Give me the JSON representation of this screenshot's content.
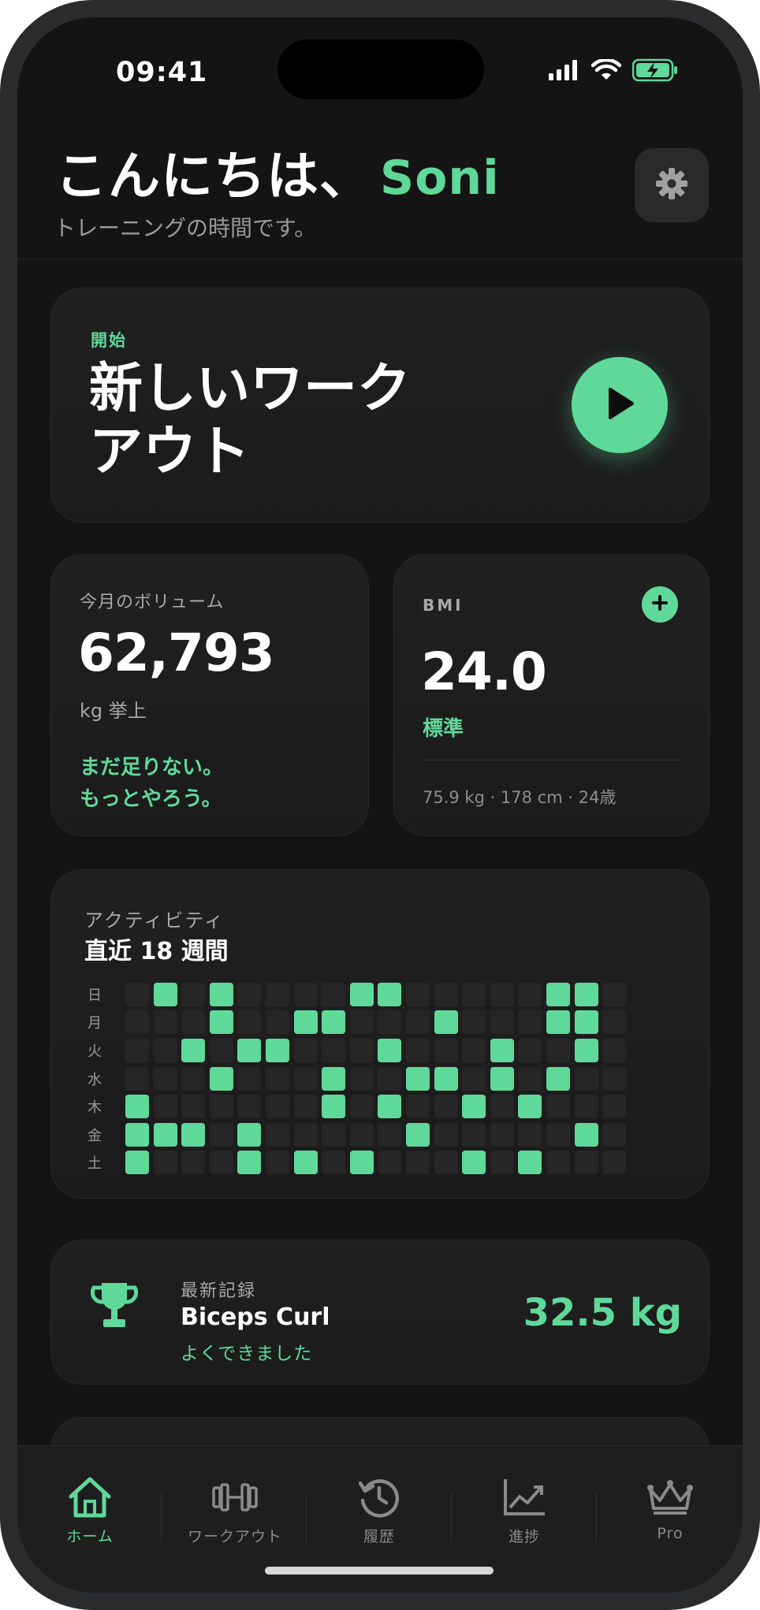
{
  "status_bar": {
    "time": "09:41"
  },
  "header": {
    "greeting": "こんにちは、",
    "user_name": "Soni",
    "subtitle": "トレーニングの時間です。",
    "settings_icon": "gear-icon"
  },
  "start_workout": {
    "eyebrow": "開始",
    "title": "新しいワークアウト",
    "play_icon": "play-icon"
  },
  "volume": {
    "label": "今月のボリューム",
    "value": "62,793",
    "unit": "kg 挙上",
    "message_line1": "まだ足りない。",
    "message_line2": "もっとやろう。"
  },
  "bmi": {
    "label": "BMI",
    "value": "24.0",
    "status": "標準",
    "detail": "75.9 kg · 178 cm · 24歳",
    "add_icon": "plus-icon"
  },
  "activity": {
    "label": "アクティビティ",
    "title": "直近 18 週間",
    "days": [
      "日",
      "月",
      "火",
      "水",
      "木",
      "金",
      "土"
    ],
    "weeks": 18,
    "active_cells": [
      [
        1,
        3,
        8,
        9,
        15,
        16
      ],
      [
        3,
        6,
        7,
        11,
        15,
        16
      ],
      [
        2,
        4,
        5,
        9,
        13,
        16
      ],
      [
        3,
        7,
        10,
        11,
        13,
        15
      ],
      [
        0,
        7,
        9,
        12,
        14
      ],
      [
        0,
        1,
        2,
        4,
        10,
        16
      ],
      [
        0,
        4,
        6,
        8,
        12,
        14
      ]
    ],
    "accent_color": "#5fd99a",
    "empty_color": "#262626"
  },
  "latest_record": {
    "label": "最新記録",
    "exercise": "Biceps Curl",
    "message": "よくできました",
    "value": "32.5 kg",
    "icon": "trophy-icon"
  },
  "tabbar": {
    "tabs": [
      {
        "label": "ホーム",
        "icon": "home-icon",
        "active": true
      },
      {
        "label": "ワークアウト",
        "icon": "dumbbell-icon",
        "active": false
      },
      {
        "label": "履歴",
        "icon": "history-icon",
        "active": false
      },
      {
        "label": "進捗",
        "icon": "chart-icon",
        "active": false
      },
      {
        "label": "Pro",
        "icon": "crown-icon",
        "active": false
      }
    ]
  },
  "colors": {
    "accent": "#5fd99a",
    "background": "#141414",
    "card": "#1e1e1e"
  }
}
